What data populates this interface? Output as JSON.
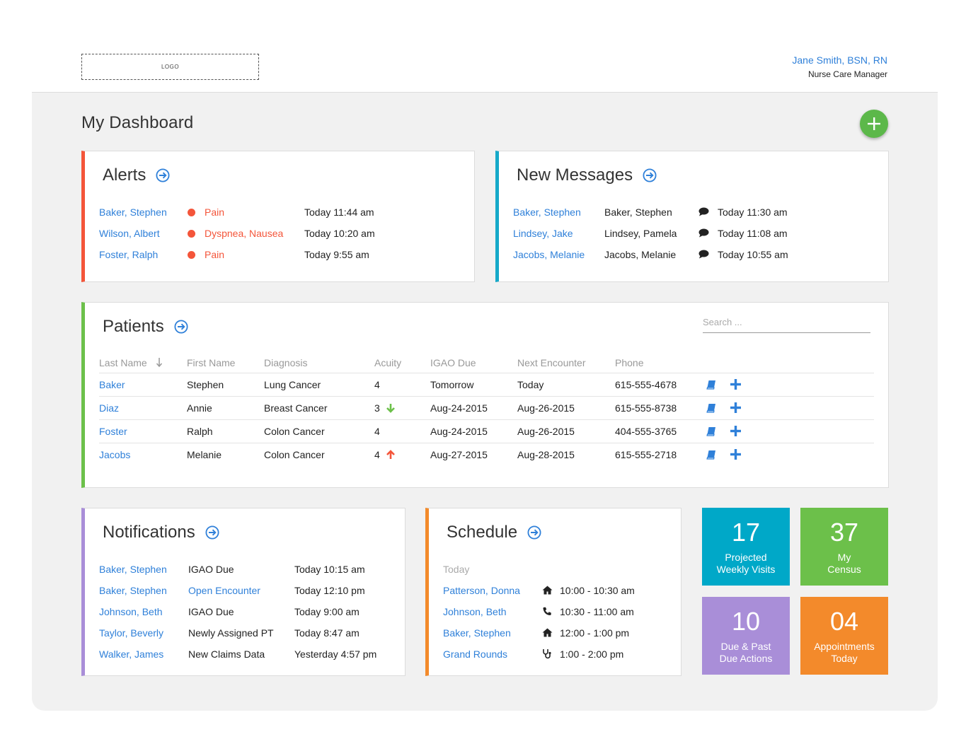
{
  "header": {
    "logo_text": "LOGO",
    "user_name": "Jane Smith, BSN, RN",
    "user_role": "Nurse Care Manager"
  },
  "page": {
    "title": "My Dashboard"
  },
  "alerts": {
    "title": "Alerts",
    "items": [
      {
        "patient": "Baker, Stephen",
        "condition": "Pain",
        "time": "Today 11:44 am"
      },
      {
        "patient": "Wilson, Albert",
        "condition": "Dyspnea, Nausea",
        "time": "Today 10:20 am"
      },
      {
        "patient": "Foster, Ralph",
        "condition": "Pain",
        "time": "Today 9:55 am"
      }
    ]
  },
  "messages": {
    "title": "New Messages",
    "items": [
      {
        "patient": "Baker, Stephen",
        "from": "Baker, Stephen",
        "time": "Today 11:30 am"
      },
      {
        "patient": "Lindsey, Jake",
        "from": "Lindsey, Pamela",
        "time": "Today 11:08 am"
      },
      {
        "patient": "Jacobs, Melanie",
        "from": "Jacobs, Melanie",
        "time": "Today 10:55 am"
      }
    ]
  },
  "patients": {
    "title": "Patients",
    "search_placeholder": "Search ...",
    "columns": [
      "Last Name",
      "First Name",
      "Diagnosis",
      "Acuity",
      "IGAO Due",
      "Next Encounter",
      "Phone"
    ],
    "rows": [
      {
        "last": "Baker",
        "first": "Stephen",
        "diagnosis": "Lung Cancer",
        "acuity": "4",
        "trend": "none",
        "igao": "Tomorrow",
        "next": "Today",
        "phone": "615-555-4678"
      },
      {
        "last": "Diaz",
        "first": "Annie",
        "diagnosis": "Breast Cancer",
        "acuity": "3",
        "trend": "down",
        "igao": "Aug-24-2015",
        "next": "Aug-26-2015",
        "phone": "615-555-8738"
      },
      {
        "last": "Foster",
        "first": "Ralph",
        "diagnosis": "Colon Cancer",
        "acuity": "4",
        "trend": "none",
        "igao": "Aug-24-2015",
        "next": "Aug-26-2015",
        "phone": "404-555-3765"
      },
      {
        "last": "Jacobs",
        "first": "Melanie",
        "diagnosis": "Colon Cancer",
        "acuity": "4",
        "trend": "up",
        "igao": "Aug-27-2015",
        "next": "Aug-28-2015",
        "phone": "615-555-2718"
      }
    ]
  },
  "notifications": {
    "title": "Notifications",
    "items": [
      {
        "patient": "Baker, Stephen",
        "type": "IGAO Due",
        "type_link": false,
        "time": "Today 10:15 am"
      },
      {
        "patient": "Baker, Stephen",
        "type": "Open Encounter",
        "type_link": true,
        "time": "Today 12:10 pm"
      },
      {
        "patient": "Johnson, Beth",
        "type": "IGAO Due",
        "type_link": false,
        "time": "Today 9:00 am"
      },
      {
        "patient": "Taylor, Beverly",
        "type": "Newly Assigned PT",
        "type_link": false,
        "time": "Today 8:47 am"
      },
      {
        "patient": "Walker, James",
        "type": "New Claims Data",
        "type_link": false,
        "time": "Yesterday 4:57 pm"
      }
    ]
  },
  "schedule": {
    "title": "Schedule",
    "day_label": "Today",
    "items": [
      {
        "name": "Patterson, Donna",
        "icon": "home-icon",
        "time": "10:00 - 10:30 am"
      },
      {
        "name": "Johnson, Beth",
        "icon": "phone-icon",
        "time": "10:30 - 11:00 am"
      },
      {
        "name": "Baker, Stephen",
        "icon": "home-icon",
        "time": "12:00 - 1:00 pm"
      },
      {
        "name": "Grand Rounds",
        "icon": "stethoscope-icon",
        "time": "1:00 - 2:00 pm"
      }
    ]
  },
  "tiles": [
    {
      "value": "17",
      "label_1": "Projected",
      "label_2": "Weekly Visits",
      "color": "#00a8c8"
    },
    {
      "value": "37",
      "label_1": "My",
      "label_2": "Census",
      "color": "#6cc04a"
    },
    {
      "value": "10",
      "label_1": "Due & Past",
      "label_2": "Due Actions",
      "color": "#a98ed8"
    },
    {
      "value": "04",
      "label_1": "Appointments",
      "label_2": "Today",
      "color": "#f38a2b"
    }
  ],
  "colors": {
    "link": "#2f80d9",
    "alert": "#f4553a",
    "trend_up": "#f4553a",
    "trend_down": "#6cc04a",
    "fab": "#5cb84a"
  }
}
